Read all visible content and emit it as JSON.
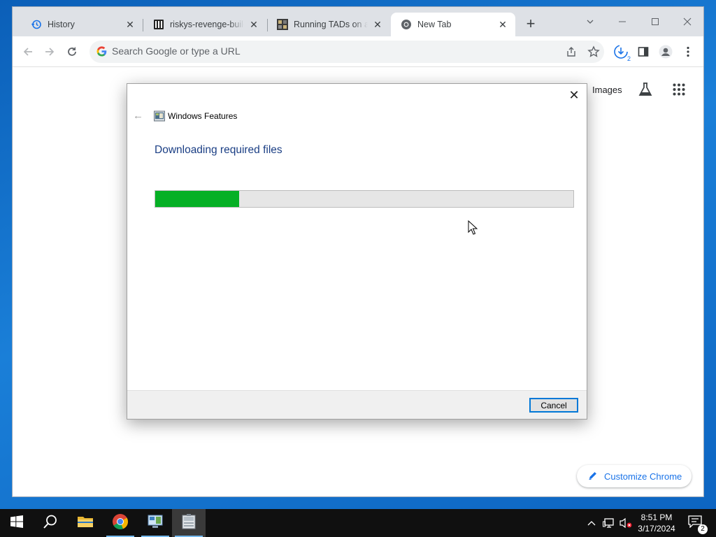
{
  "browser": {
    "tabs": [
      {
        "title": "History",
        "icon": "history-icon",
        "active": false
      },
      {
        "title": "riskys-revenge-builds",
        "icon": "github-icon",
        "active": false
      },
      {
        "title": "Running TADs on a re",
        "icon": "site-favicon",
        "active": false
      },
      {
        "title": "New Tab",
        "icon": "chrome-icon",
        "active": true
      }
    ],
    "new_tab_symbol": "+",
    "omnibox_placeholder": "Search Google or type a URL",
    "downloads_count": "2"
  },
  "ntp": {
    "images_link": "Images",
    "customize_label": "Customize Chrome"
  },
  "dialog": {
    "app_title": "Windows Features",
    "heading": "Downloading required files",
    "progress_fraction": 0.2,
    "cancel_label": "Cancel",
    "close_symbol": "✕",
    "back_symbol": "←"
  },
  "taskbar": {
    "apps": [
      "windows-start",
      "search",
      "file-explorer",
      "chrome",
      "control-panel",
      "windows-features"
    ],
    "time": "8:51 PM",
    "date": "3/17/2024",
    "notification_count": "2"
  },
  "colors": {
    "progress_green": "#06b025",
    "accent_blue": "#1a73e8",
    "dialog_heading": "#1a3e84",
    "taskbar": "#101010"
  }
}
